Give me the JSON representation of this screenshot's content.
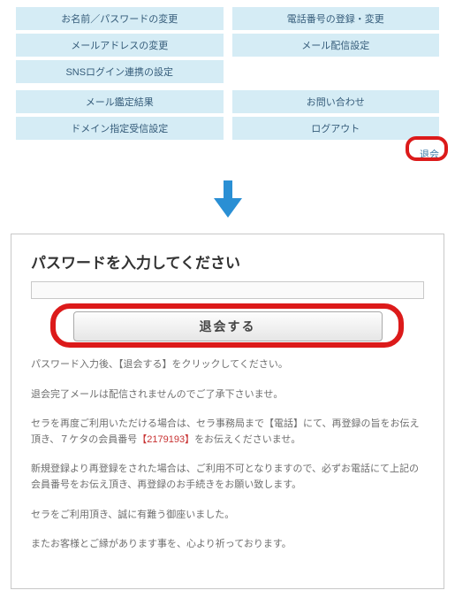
{
  "menu": {
    "group1": [
      "お名前／パスワードの変更",
      "電話番号の登録・変更",
      "メールアドレスの変更",
      "メール配信設定",
      "SNSログイン連携の設定"
    ],
    "group2": [
      "メール鑑定結果",
      "お問い合わせ",
      "ドメイン指定受信設定",
      "ログアウト"
    ]
  },
  "logout_link": "退会",
  "card": {
    "title": "パスワードを入力してください",
    "submit": "退会する",
    "notes": {
      "n1": "パスワード入力後、【退会する】をクリックしてください。",
      "n2": "退会完了メールは配信されませんのでご了承下さいませ。",
      "n3_a": "セラを再度ご利用いただける場合は、セラ事務局まで【電話】にて、再登録の旨をお伝え頂き、７ケタの会員番号",
      "n3_b": "【2179193】",
      "n3_c": "をお伝えくださいませ。",
      "n4": "新規登録より再登録をされた場合は、ご利用不可となりますので、必ずお電話にて上記の会員番号をお伝え頂き、再登録のお手続きをお願い致します。",
      "n5": "セラをご利用頂き、誠に有難う御座いました。",
      "n6": "またお客様とご縁があります事を、心より祈っております。"
    }
  },
  "colors": {
    "menu_bg": "#d5ecf5",
    "annot": "#dc1a1a",
    "link": "#3d7aa6"
  }
}
